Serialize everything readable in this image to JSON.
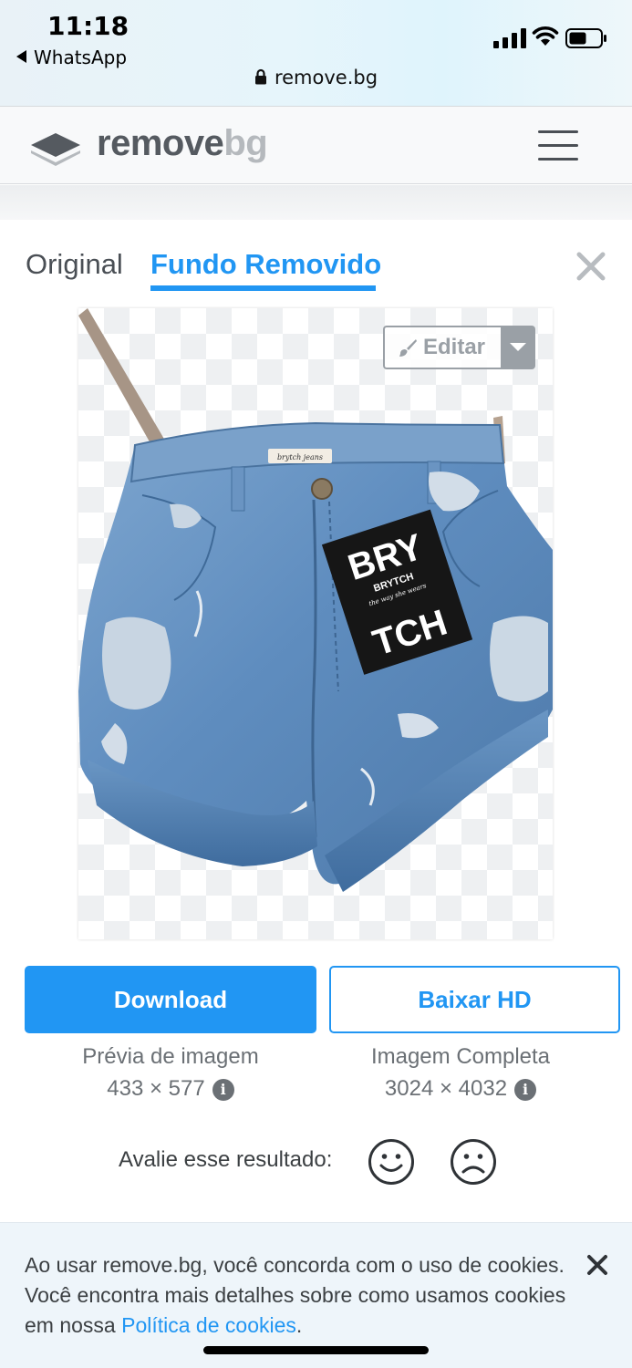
{
  "status_bar": {
    "time": "11:18",
    "back_app": "WhatsApp",
    "url": "remove.bg"
  },
  "header": {
    "logo_part1": "remove",
    "logo_part2": "bg",
    "menu_icon": "hamburger-icon"
  },
  "tabs": [
    {
      "label": "Original",
      "active": false
    },
    {
      "label": "Fundo Removido",
      "active": true
    }
  ],
  "editor": {
    "edit_label": "Editar"
  },
  "product_image": {
    "tag_text_top": "BRY",
    "tag_text_bottom": "TCH",
    "tag_brand": "BRYTCH",
    "tag_slogan": "the way she wears",
    "waistband_label": "brytch jeans"
  },
  "actions": {
    "download_label": "Download",
    "download_hd_label": "Baixar HD",
    "preview_caption": "Prévia de imagem",
    "preview_size": "433 × 577",
    "full_caption": "Imagem Completa",
    "full_size": "3024 × 4032"
  },
  "rating": {
    "label": "Avalie esse resultado:"
  },
  "cookie_banner": {
    "text_before": "Ao usar remove.bg, você concorda com o uso de cookies. Você encontra mais detalhes sobre como usamos cookies em nossa ",
    "link_text": "Política de cookies",
    "text_after": "."
  },
  "colors": {
    "accent": "#2196f3",
    "logo_dark": "#555a60",
    "logo_light": "#b5b9bd"
  }
}
